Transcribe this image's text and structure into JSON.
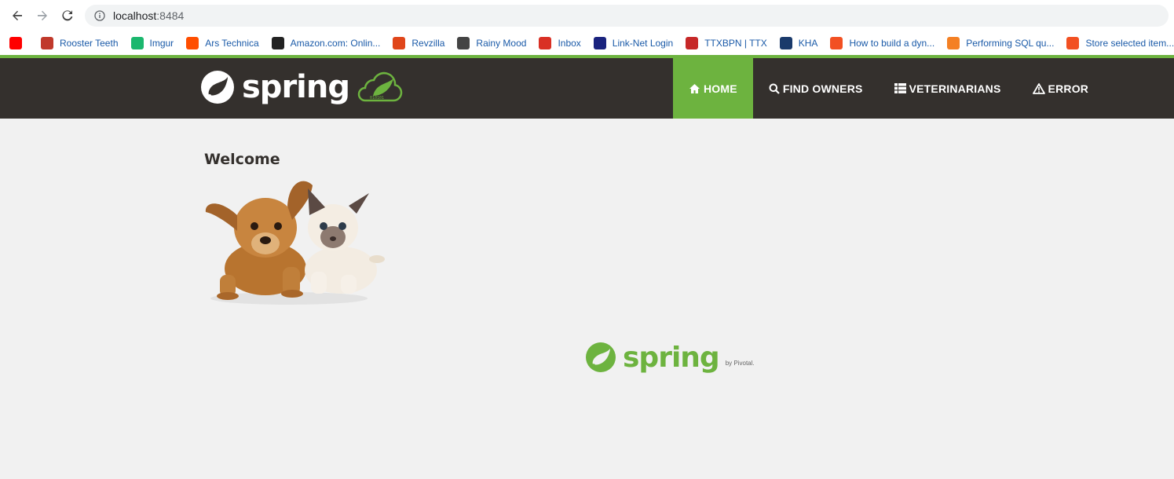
{
  "browser": {
    "url_host": "localhost",
    "url_port": ":8484",
    "bookmarks": [
      {
        "label": "",
        "icon": "youtube-icon",
        "color": "#ff0000"
      },
      {
        "label": "Rooster Teeth",
        "icon": "rooster-teeth-icon",
        "color": "#c0392b"
      },
      {
        "label": "Imgur",
        "icon": "imgur-icon",
        "color": "#1bb76e"
      },
      {
        "label": "Ars Technica",
        "icon": "ars-icon",
        "color": "#ff4e00"
      },
      {
        "label": "Amazon.com: Onlin...",
        "icon": "amazon-icon",
        "color": "#222222"
      },
      {
        "label": "Revzilla",
        "icon": "revzilla-icon",
        "color": "#e0461a"
      },
      {
        "label": "Rainy Mood",
        "icon": "rainy-mood-icon",
        "color": "#444444"
      },
      {
        "label": "Inbox",
        "icon": "gmail-icon",
        "color": "#d93025"
      },
      {
        "label": "Link-Net Login",
        "icon": "linknet-icon",
        "color": "#1a237e"
      },
      {
        "label": "TTXBPN | TTX",
        "icon": "ttx-icon",
        "color": "#c62828"
      },
      {
        "label": "KHA",
        "icon": "kha-icon",
        "color": "#1a3a6b"
      },
      {
        "label": "How to build a dyn...",
        "icon": "microsoft-icon",
        "color": "#f25022"
      },
      {
        "label": "Performing SQL qu...",
        "icon": "stackoverflow-icon",
        "color": "#f48024"
      },
      {
        "label": "Store selected item...",
        "icon": "microsoft-icon",
        "color": "#f25022"
      }
    ]
  },
  "app": {
    "brand": "spring",
    "nav": [
      {
        "label": "HOME",
        "icon": "home-icon",
        "active": true
      },
      {
        "label": "FIND OWNERS",
        "icon": "search-icon",
        "active": false
      },
      {
        "label": "VETERINARIANS",
        "icon": "list-icon",
        "active": false
      },
      {
        "label": "ERROR",
        "icon": "warning-icon",
        "active": false
      }
    ],
    "title": "Welcome",
    "footer_brand": "spring",
    "footer_by": "by Pivotal."
  },
  "colors": {
    "accent": "#6db33f",
    "navbar": "#34302d",
    "background": "#f1f1f1"
  }
}
